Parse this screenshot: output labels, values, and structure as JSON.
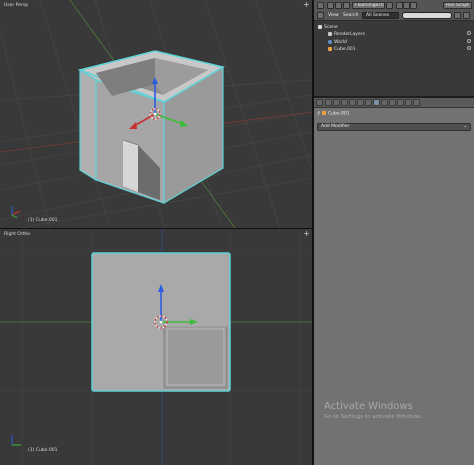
{
  "viewport_top": {
    "label": "User Persp",
    "status": "(1) Cube.001"
  },
  "viewport_bottom": {
    "label": "Right Ortho",
    "status": "(1) Cube.001"
  },
  "outliner": {
    "file_name": "FloorOrigin.txt",
    "run_script_label": "Run Script",
    "view_menu": "View",
    "search_menu": "Search",
    "scene_filter": "All Scenes",
    "tree": [
      {
        "label": "Scene",
        "icon": "scene-icon",
        "indent": 0
      },
      {
        "label": "RenderLayers",
        "icon": "renderlayers-icon",
        "indent": 1
      },
      {
        "label": "World",
        "icon": "world-icon",
        "indent": 1
      },
      {
        "label": "Cube.001",
        "icon": "mesh-object-icon",
        "indent": 1
      }
    ]
  },
  "properties": {
    "breadcrumb": "Cube.001",
    "add_modifier": "Add Modifier",
    "tabs": [
      "render-icon",
      "renderlayers-icon",
      "scene-icon",
      "world-icon",
      "object-icon",
      "constraints-icon",
      "modifier-icon",
      "data-icon",
      "material-icon",
      "texture-icon",
      "particles-icon",
      "physics-icon"
    ],
    "active_tab_index": 6
  },
  "watermark": {
    "title": "Activate Windows",
    "subtitle": "Go to Settings to activate Windows."
  },
  "colors": {
    "viewport_bg": "#393939",
    "panel_bg": "#727272",
    "selection_outline": "#5fd3d8",
    "axis_x": "#c83232",
    "axis_y": "#3cbe3c",
    "axis_z": "#2a5de0"
  }
}
